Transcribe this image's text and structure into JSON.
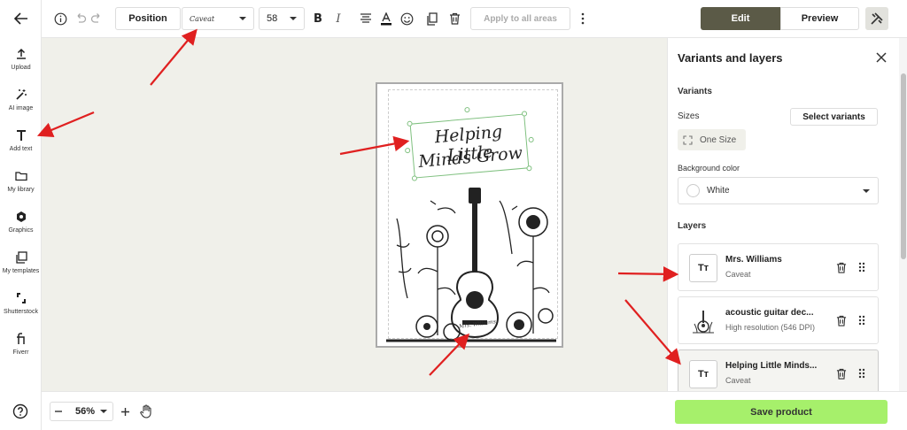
{
  "sidebar": {
    "items": [
      {
        "label": "Upload",
        "icon": "upload-icon"
      },
      {
        "label": "AI image",
        "icon": "magic-wand-icon"
      },
      {
        "label": "Add text",
        "icon": "text-icon"
      },
      {
        "label": "My library",
        "icon": "folder-icon"
      },
      {
        "label": "Graphics",
        "icon": "shapes-icon"
      },
      {
        "label": "My templates",
        "icon": "templates-icon"
      },
      {
        "label": "Shutterstock",
        "icon": "shutterstock-icon"
      },
      {
        "label": "Fiverr",
        "icon": "fiverr-icon"
      }
    ]
  },
  "toolbar": {
    "position_label": "Position",
    "font_name": "Caveat",
    "font_size": "58",
    "apply_label": "Apply to all areas",
    "edit_label": "Edit",
    "preview_label": "Preview"
  },
  "canvas": {
    "title_line1": "Helping Little",
    "title_line2": "Minds Grow",
    "signature": "Mrs. Williams"
  },
  "panel": {
    "title": "Variants and layers",
    "variants_heading": "Variants",
    "sizes_label": "Sizes",
    "select_variants_label": "Select variants",
    "size_value": "One Size",
    "bg_color_label": "Background color",
    "bg_color_value": "White",
    "layers_heading": "Layers",
    "layers": [
      {
        "name": "Mrs. Williams",
        "sub": "Caveat",
        "thumb": "Tт"
      },
      {
        "name": "acoustic guitar dec...",
        "sub": "High resolution (546 DPI)",
        "thumb": ""
      },
      {
        "name": "Helping Little Minds...",
        "sub": "Caveat",
        "thumb": "Tт"
      }
    ]
  },
  "bottom": {
    "zoom": "56%",
    "save_label": "Save product"
  },
  "colors": {
    "edit_bg": "#5b5a47",
    "save_bg": "#a6f06b",
    "canvas_bg": "#f0f0ea",
    "arrow": "#e02020"
  }
}
